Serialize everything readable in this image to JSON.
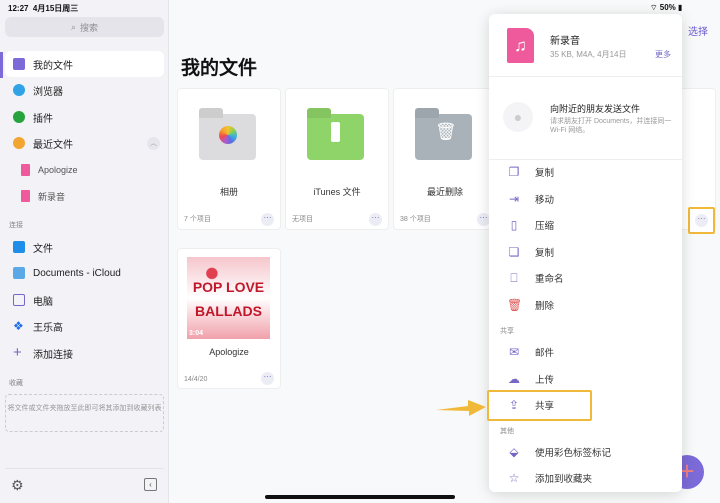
{
  "status": {
    "time": "12:27",
    "date": "4月15日周三",
    "battery": "50%"
  },
  "sidebar": {
    "search_placeholder": "搜索",
    "items": [
      {
        "label": "我的文件"
      },
      {
        "label": "浏览器"
      },
      {
        "label": "插件"
      },
      {
        "label": "最近文件"
      }
    ],
    "recent": [
      {
        "label": "Apologize"
      },
      {
        "label": "新录音"
      }
    ],
    "connections_header": "连接",
    "connections": [
      {
        "label": "文件"
      },
      {
        "label": "Documents - iCloud"
      },
      {
        "label": "电脑"
      },
      {
        "label": "王乐高"
      },
      {
        "label": "添加连接"
      }
    ],
    "favorites_header": "收藏",
    "favorites_hint": "将文件或文件夹拖放至此即可将其添加到收藏列表"
  },
  "main": {
    "title": "我的文件",
    "select": "选择",
    "cards": [
      {
        "name": "相册",
        "meta": "7 个项目"
      },
      {
        "name": "iTunes 文件",
        "meta": "无项目"
      },
      {
        "name": "最近删除",
        "meta": "38 个项目"
      },
      {
        "name": "Apologize",
        "meta": "14/4/20",
        "duration": "3:04",
        "art_line1": "POP LOVE",
        "art_line2": "BALLADS"
      }
    ]
  },
  "popover": {
    "file_name": "新录音",
    "file_info": "35 KB, M4A, 4月14日",
    "more": "更多",
    "nearby_title": "向附近的朋友发送文件",
    "nearby_desc": "请求朋友打开 Documents，并连接同一 Wi-Fi 网络。",
    "actions": [
      {
        "label": "复制"
      },
      {
        "label": "移动"
      },
      {
        "label": "压缩"
      },
      {
        "label": "复制"
      },
      {
        "label": "重命名"
      },
      {
        "label": "删除"
      }
    ],
    "share_header": "共享",
    "share": [
      {
        "label": "邮件"
      },
      {
        "label": "上传"
      },
      {
        "label": "共享"
      }
    ],
    "other_header": "其他",
    "other": [
      {
        "label": "使用彩色标签标记"
      },
      {
        "label": "添加到收藏夹"
      }
    ]
  },
  "colors": {
    "accent": "#6b5bd0",
    "highlight": "#f0b93a",
    "music": "#ee5a9b"
  }
}
